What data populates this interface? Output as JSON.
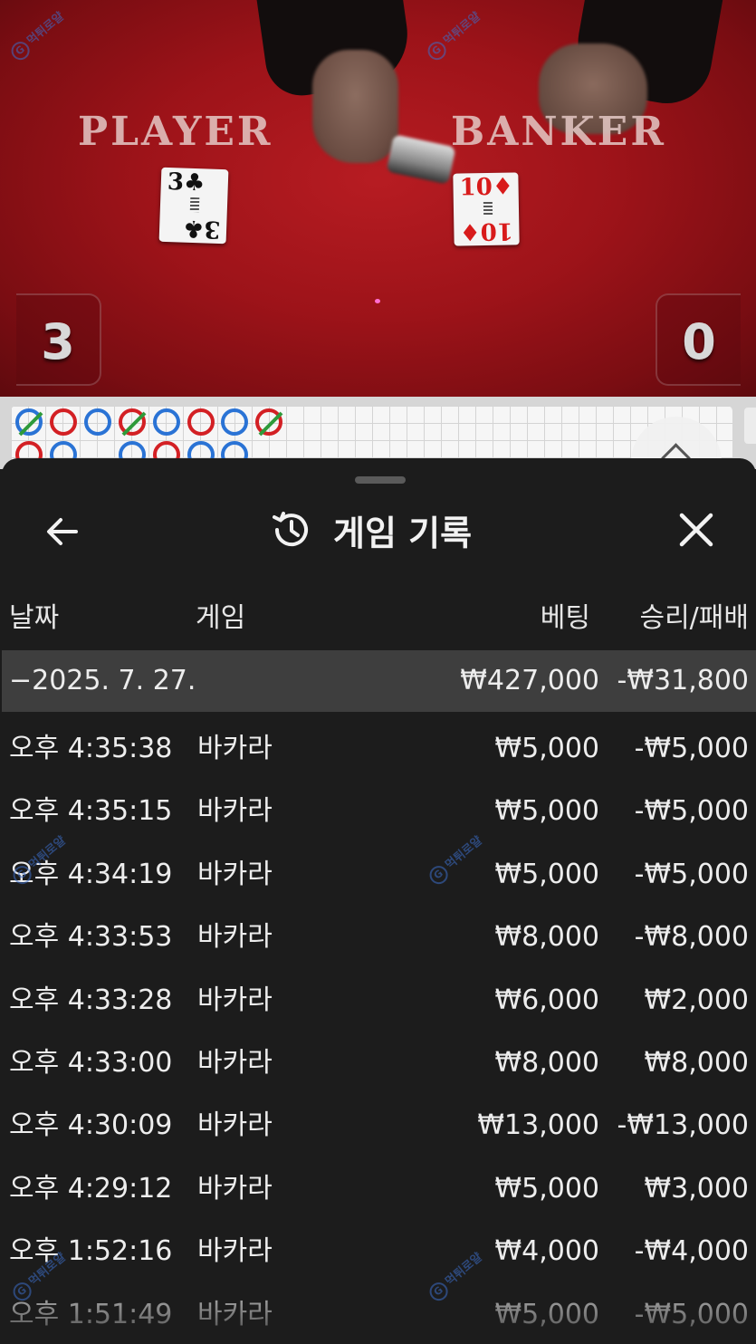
{
  "video": {
    "player_label": "PLAYER",
    "banker_label": "BANKER",
    "player_card": {
      "rank": "3",
      "suit": "♣"
    },
    "banker_card": {
      "rank": "10",
      "suit": "♦"
    },
    "player_score": "3",
    "banker_score": "0"
  },
  "road": {
    "beads": [
      "tie-b",
      "r",
      "b",
      "tie-r",
      "b",
      "r",
      "b",
      "tie-r"
    ],
    "second_row": [
      "r",
      "b",
      "",
      "b",
      "r",
      "b",
      "b"
    ]
  },
  "header": {
    "title": "게임 기록",
    "back_icon": "back-arrow-icon",
    "history_icon": "history-icon",
    "close_icon": "close-icon"
  },
  "columns": {
    "date": "날짜",
    "game": "게임",
    "bet": "베팅",
    "win_loss": "승리/패배"
  },
  "summary": {
    "date": "−2025. 7. 27.",
    "bet": "₩427,000",
    "win_loss": "-₩31,800"
  },
  "rows": [
    {
      "time": "오후 4:35:38",
      "game": "바카라",
      "bet": "₩5,000",
      "win_loss": "-₩5,000"
    },
    {
      "time": "오후 4:35:15",
      "game": "바카라",
      "bet": "₩5,000",
      "win_loss": "-₩5,000"
    },
    {
      "time": "오후 4:34:19",
      "game": "바카라",
      "bet": "₩5,000",
      "win_loss": "-₩5,000"
    },
    {
      "time": "오후 4:33:53",
      "game": "바카라",
      "bet": "₩8,000",
      "win_loss": "-₩8,000"
    },
    {
      "time": "오후 4:33:28",
      "game": "바카라",
      "bet": "₩6,000",
      "win_loss": "₩2,000"
    },
    {
      "time": "오후 4:33:00",
      "game": "바카라",
      "bet": "₩8,000",
      "win_loss": "₩8,000"
    },
    {
      "time": "오후 4:30:09",
      "game": "바카라",
      "bet": "₩13,000",
      "win_loss": "-₩13,000"
    },
    {
      "time": "오후 4:29:12",
      "game": "바카라",
      "bet": "₩5,000",
      "win_loss": "₩3,000"
    },
    {
      "time": "오후 1:52:16",
      "game": "바카라",
      "bet": "₩4,000",
      "win_loss": "-₩4,000"
    },
    {
      "time": "오후 1:51:49",
      "game": "바카라",
      "bet": "₩5,000",
      "win_loss": "-₩5,000"
    }
  ],
  "watermark": "먹튀로얄"
}
